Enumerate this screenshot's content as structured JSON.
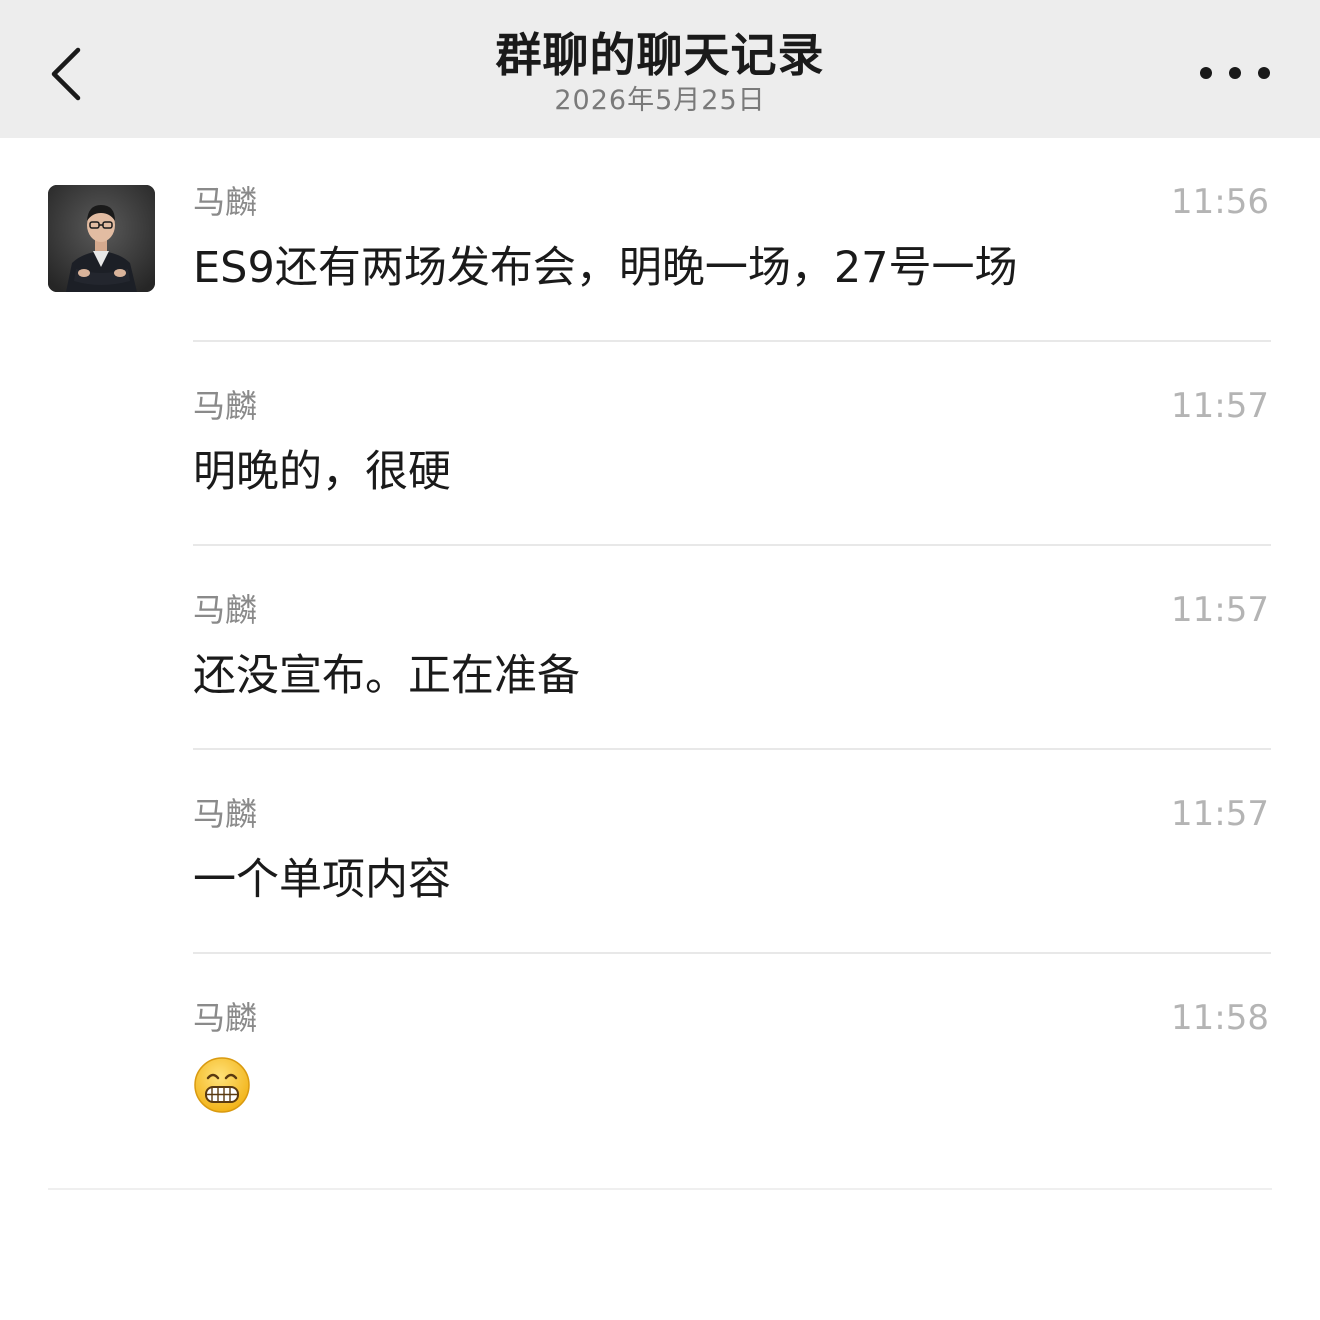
{
  "header": {
    "title": "群聊的聊天记录",
    "subtitle": "2026年5月25日",
    "back_icon": "chevron-left-icon",
    "more_icon": "more-dots-icon"
  },
  "messages": [
    {
      "sender": "马麟",
      "time": "11:56",
      "text": "ES9还有两场发布会，明晚一场，27号一场"
    },
    {
      "sender": "马麟",
      "time": "11:57",
      "text": "明晚的，很硬"
    },
    {
      "sender": "马麟",
      "time": "11:57",
      "text": "还没宣布。正在准备"
    },
    {
      "sender": "马麟",
      "time": "11:57",
      "text": "一个单项内容"
    },
    {
      "sender": "马麟",
      "time": "11:58",
      "emoji": "grinning-face-icon"
    }
  ],
  "colors": {
    "header_bg": "#ededed",
    "text_primary": "#1a1a1a",
    "text_secondary": "#8a8a8a",
    "time": "#b4b4b4",
    "emoji_face": "#f7c531"
  }
}
